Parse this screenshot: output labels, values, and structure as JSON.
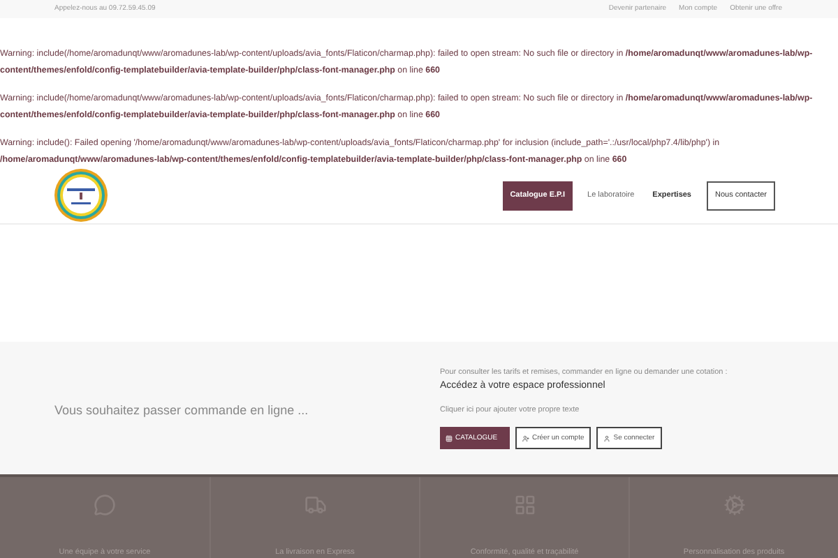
{
  "top_bar": {
    "phone": "Appelez-nous au 09.72.59.45.09",
    "links": [
      "Devenir partenaire",
      "Mon compte",
      "Obtenir une offre"
    ]
  },
  "warnings": [
    {
      "label": "Warning",
      "text": ": include(/home/aromadunqt/www/aromadunes-lab/wp-content/uploads/avia_fonts/Flaticon/charmap.php): failed to open stream: No such file or directory in ",
      "path": "/home/aromadunqt/www/aromadunes-lab/wp-content/themes/enfold/config-templatebuilder/avia-template-builder/php/class-font-manager.php",
      "line_text": " on line ",
      "line": "660"
    },
    {
      "label": "Warning",
      "text": ": include(/home/aromadunqt/www/aromadunes-lab/wp-content/uploads/avia_fonts/Flaticon/charmap.php): failed to open stream: No such file or directory in ",
      "path": "/home/aromadunqt/www/aromadunes-lab/wp-content/themes/enfold/config-templatebuilder/avia-template-builder/php/class-font-manager.php",
      "line_text": " on line ",
      "line": "660"
    },
    {
      "label": "Warning",
      "text": ": include(): Failed opening '/home/aromadunqt/www/aromadunes-lab/wp-content/uploads/avia_fonts/Flaticon/charmap.php' for inclusion (include_path='.:/usr/local/php7.4/lib/php') in ",
      "path": "/home/aromadunqt/www/aromadunes-lab/wp-content/themes/enfold/config-templatebuilder/avia-template-builder/php/class-font-manager.php",
      "line_text": " on line ",
      "line": "660"
    }
  ],
  "nav": [
    {
      "label": "Catalogue E.P.I",
      "kind": "filled",
      "selected": true
    },
    {
      "label": "Le laboratoire",
      "kind": "plain",
      "selected": false
    },
    {
      "label": "Expertises",
      "kind": "strong",
      "selected": false
    },
    {
      "label": "Nous contacter",
      "kind": "outline",
      "selected": false
    }
  ],
  "order": {
    "heading": "Vous souhaitez passer commande en ligne ...",
    "intro": "Pour consulter les tarifs et remises, commander en ligne ou demander une cotation :",
    "title": "Accédez à votre espace professionnel",
    "note": "Cliquer ici pour ajouter votre propre texte",
    "buttons": [
      {
        "label": "CATALOGUE",
        "kind": "filled"
      },
      {
        "label": "Créer un compte",
        "kind": "outline"
      },
      {
        "label": "Se connecter",
        "kind": "outline"
      }
    ]
  },
  "features": [
    {
      "label": "Une équipe à votre service"
    },
    {
      "label": "La livraison en Express"
    },
    {
      "label": "Conformité, qualité et traçabilité"
    },
    {
      "label": "Personnalisation des produits"
    }
  ]
}
